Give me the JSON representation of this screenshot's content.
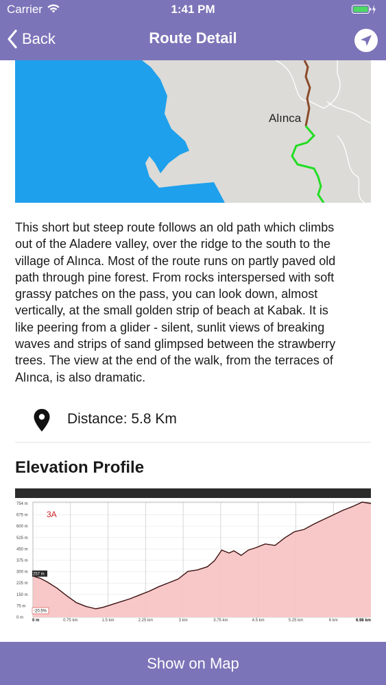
{
  "status": {
    "carrier": "Carrier",
    "time": "1:41 PM"
  },
  "nav": {
    "back_label": "Back",
    "title": "Route Detail"
  },
  "map": {
    "place_label": "Alınca"
  },
  "description": "This short but steep route follows an old path which climbs\nout of the Aladere valley, over the ridge to the south to the\nvillage of Alınca. Most of the route runs on partly paved old\npath through pine forest. From rocks interspersed with soft\ngrassy patches on the pass, you can look down, almost\nvertically, at the small golden strip of beach at Kabak. It is\nlike peering from a glider - silent, sunlit views of breaking\nwaves and strips of sand glimpsed between the strawberry\ntrees. The view at the end of the walk, from the terraces of\nAlınca, is also dramatic.",
  "distance": {
    "label": "Distance: 5.8 Km"
  },
  "elevation": {
    "title": "Elevation Profile"
  },
  "chart_data": {
    "type": "area",
    "annotation": "3A",
    "start_label": "257 m",
    "grade_label": "-20.5%",
    "y_ticks": [
      "754 m",
      "675 m",
      "600 m",
      "525 m",
      "450 m",
      "375 m",
      "300 m",
      "225 m",
      "150 m",
      "75 m",
      "0 m"
    ],
    "x_ticks": [
      "0 m",
      "0.75 km",
      "1.5 km",
      "2.25 km",
      "3 km",
      "3.75 km",
      "4.5 km",
      "5.25 km",
      "6 km",
      "6.98 km"
    ],
    "ylim": [
      0,
      754
    ],
    "xlim": [
      0,
      6.98
    ],
    "x": [
      0,
      0.15,
      0.3,
      0.5,
      0.7,
      0.9,
      1.1,
      1.3,
      1.45,
      1.6,
      1.8,
      2.0,
      2.2,
      2.4,
      2.6,
      2.8,
      3.0,
      3.2,
      3.4,
      3.6,
      3.75,
      3.9,
      4.05,
      4.15,
      4.3,
      4.45,
      4.6,
      4.8,
      5.0,
      5.2,
      5.4,
      5.6,
      5.8,
      6.0,
      6.2,
      6.4,
      6.6,
      6.8,
      6.98
    ],
    "y": [
      270,
      255,
      230,
      190,
      140,
      95,
      70,
      55,
      65,
      80,
      100,
      120,
      145,
      170,
      200,
      225,
      250,
      300,
      310,
      330,
      370,
      440,
      420,
      435,
      405,
      440,
      455,
      480,
      470,
      520,
      560,
      575,
      610,
      640,
      670,
      700,
      725,
      754,
      745
    ],
    "colors": {
      "fill": "#f7c2c2",
      "line": "#3a1010",
      "header": "#2b2b2b",
      "accent": "#cc2222"
    }
  },
  "footer": {
    "button_label": "Show on Map"
  }
}
